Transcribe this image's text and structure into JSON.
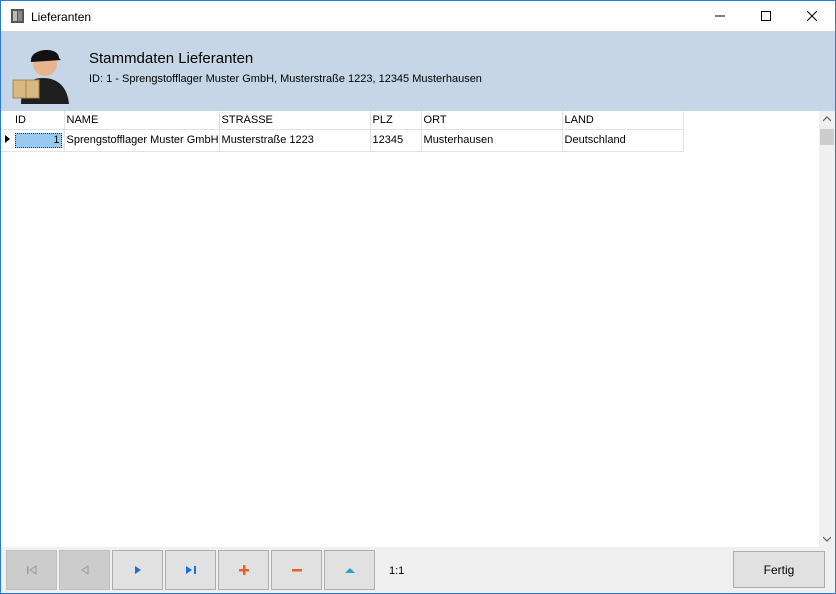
{
  "window": {
    "title": "Lieferanten"
  },
  "header": {
    "title": "Stammdaten Lieferanten",
    "subtitle": "ID: 1 - Sprengstofflager Muster GmbH, Musterstraße 1223, 12345 Musterhausen"
  },
  "grid": {
    "columns": [
      "ID",
      "NAME",
      "STRASSE",
      "PLZ",
      "ORT",
      "LAND"
    ],
    "rows": [
      {
        "id": "1",
        "name": "Sprengstofflager Muster GmbH",
        "strasse": "Musterstraße 1223",
        "plz": "12345",
        "ort": "Musterhausen",
        "land": "Deutschland"
      }
    ]
  },
  "navigator": {
    "position": "1:1",
    "buttons": [
      "first-icon",
      "prior-icon",
      "next-icon",
      "last-icon",
      "insert-icon",
      "delete-icon",
      "edit-icon"
    ]
  },
  "footer": {
    "done_label": "Fertig"
  },
  "colors": {
    "header_bg": "#c7d6e6",
    "selection": "#99c9ef",
    "nav_blue": "#1e6fd0",
    "nav_orange": "#e8602c",
    "nav_teal": "#2aa3c9"
  }
}
